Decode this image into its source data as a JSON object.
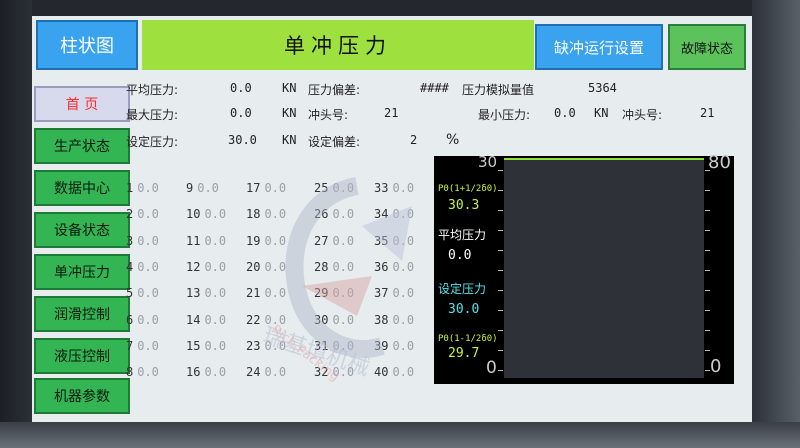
{
  "header": {
    "bar_chart_button": "柱状图",
    "title": "单冲压力",
    "missing_punch_button": "缺冲运行设置",
    "fault_button": "故障状态"
  },
  "sidebar": {
    "items": [
      {
        "label": "首 页"
      },
      {
        "label": "生产状态"
      },
      {
        "label": "数据中心"
      },
      {
        "label": "设备状态"
      },
      {
        "label": "单冲压力"
      },
      {
        "label": "润滑控制"
      },
      {
        "label": "液压控制"
      },
      {
        "label": "机器参数"
      }
    ]
  },
  "info": {
    "avg_label": "平均压力:",
    "avg_value": "0.0",
    "avg_unit": "KN",
    "dev_label": "压力偏差:",
    "dev_value": "####",
    "analog_label": "压力模拟量值",
    "analog_value": "5364",
    "max_label": "最大压力:",
    "max_value": "0.0",
    "max_unit": "KN",
    "max_punch_label": "冲头号:",
    "max_punch_value": "21",
    "min_label": "最小压力:",
    "min_value": "0.0",
    "min_unit": "KN",
    "min_punch_label": "冲头号:",
    "min_punch_value": "21",
    "set_label": "设定压力:",
    "set_value": "30.0",
    "set_unit": "KN",
    "setdev_label": "设定偏差:",
    "setdev_value": "2",
    "setdev_unit": "%"
  },
  "punches": [
    [
      "1",
      "0.0"
    ],
    [
      "2",
      "0.0"
    ],
    [
      "3",
      "0.0"
    ],
    [
      "4",
      "0.0"
    ],
    [
      "5",
      "0.0"
    ],
    [
      "6",
      "0.0"
    ],
    [
      "7",
      "0.0"
    ],
    [
      "8",
      "0.0"
    ],
    [
      "9",
      "0.0"
    ],
    [
      "10",
      "0.0"
    ],
    [
      "11",
      "0.0"
    ],
    [
      "12",
      "0.0"
    ],
    [
      "13",
      "0.0"
    ],
    [
      "14",
      "0.0"
    ],
    [
      "15",
      "0.0"
    ],
    [
      "16",
      "0.0"
    ],
    [
      "17",
      "0.0"
    ],
    [
      "18",
      "0.0"
    ],
    [
      "19",
      "0.0"
    ],
    [
      "20",
      "0.0"
    ],
    [
      "21",
      "0.0"
    ],
    [
      "22",
      "0.0"
    ],
    [
      "23",
      "0.0"
    ],
    [
      "24",
      "0.0"
    ],
    [
      "25",
      "0.0"
    ],
    [
      "26",
      "0.0"
    ],
    [
      "27",
      "0.0"
    ],
    [
      "28",
      "0.0"
    ],
    [
      "29",
      "0.0"
    ],
    [
      "30",
      "0.0"
    ],
    [
      "31",
      "0.0"
    ],
    [
      "32",
      "0.0"
    ],
    [
      "33",
      "0.0"
    ],
    [
      "34",
      "0.0"
    ],
    [
      "35",
      "0.0"
    ],
    [
      "36",
      "0.0"
    ],
    [
      "37",
      "0.0"
    ],
    [
      "38",
      "0.0"
    ],
    [
      "39",
      "0.0"
    ],
    [
      "40",
      "0.0"
    ]
  ],
  "trend": {
    "y_max_left": "30",
    "y_min_left": "0",
    "y_max_right": "80",
    "y_min_right": "0",
    "upper_label": "P0(1+1/2δ0)",
    "upper_value": "30.3",
    "avg_label": "平均压力",
    "avg_value": "0.0",
    "set_label": "设定压力",
    "set_value": "30.0",
    "lower_label": "P0(1-1/2δ0)",
    "lower_value": "29.7"
  },
  "watermark": {
    "brand_cn": "瑞基填机械",
    "brand_en": "Rich Packing"
  },
  "colors": {
    "title_bar": "#9ee03d",
    "side_button": "#32b552",
    "blue_button": "#39a3f0",
    "trend_bg": "#000000"
  }
}
